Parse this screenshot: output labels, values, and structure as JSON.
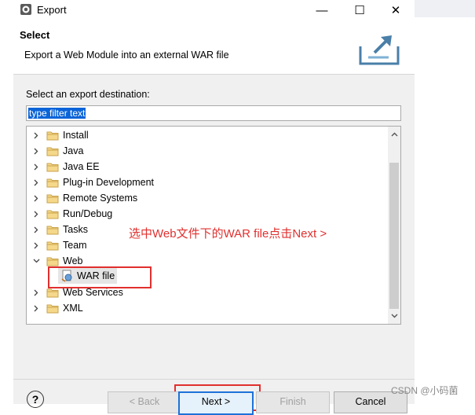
{
  "window": {
    "title": "Export",
    "minimize_glyph": "—",
    "maximize_glyph": "☐",
    "close_glyph": "✕"
  },
  "header": {
    "title": "Select",
    "description": "Export a Web Module into an external WAR file",
    "icon": "export-wizard-icon"
  },
  "destination": {
    "label": "Select an export destination:",
    "filter_value": "type filter text"
  },
  "tree": {
    "items": [
      {
        "label": "Install",
        "expanded": false
      },
      {
        "label": "Java",
        "expanded": false
      },
      {
        "label": "Java EE",
        "expanded": false
      },
      {
        "label": "Plug-in Development",
        "expanded": false
      },
      {
        "label": "Remote Systems",
        "expanded": false
      },
      {
        "label": "Run/Debug",
        "expanded": false
      },
      {
        "label": "Tasks",
        "expanded": false
      },
      {
        "label": "Team",
        "expanded": false
      },
      {
        "label": "Web",
        "expanded": true
      },
      {
        "label": "Web Services",
        "expanded": false
      },
      {
        "label": "XML",
        "expanded": false
      }
    ],
    "selected_child": {
      "label": "WAR file",
      "icon": "war-file-icon"
    }
  },
  "annotation": {
    "text": "选中Web文件下的WAR file点击Next >",
    "color": "#e0302e"
  },
  "buttons": {
    "help": "?",
    "back": "< Back",
    "next": "Next >",
    "finish": "Finish",
    "cancel": "Cancel"
  },
  "watermark": "CSDN @小码菌",
  "colors": {
    "accent": "#1d72d8",
    "selection": "#0a64d8",
    "annotation": "#e0302e"
  }
}
